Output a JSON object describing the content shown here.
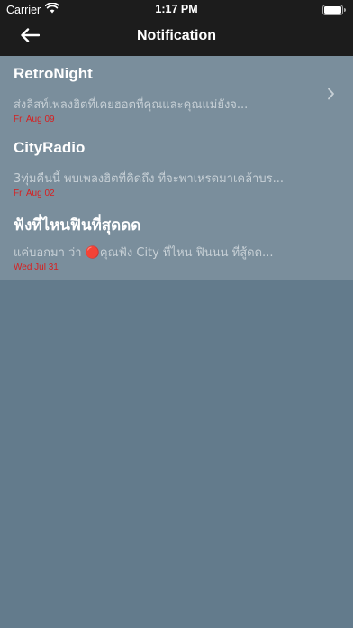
{
  "status_bar": {
    "carrier": "Carrier",
    "time": "1:17 PM",
    "icons": [
      "wifi-icon",
      "battery-icon"
    ]
  },
  "nav": {
    "title": "Notification",
    "back_icon": "back-arrow-icon"
  },
  "notifications": [
    {
      "title": "RetroNight",
      "body": "ส่งลิสท์เพลงฮิตที่เคยฮอตที่คุณและคุณแม่ยังจ...",
      "date": "Fri Aug 09",
      "has_chevron": true
    },
    {
      "title": "CityRadio",
      "body": "3ทุ่มคืนนี้ พบเพลงฮิตที่คิดถึง ที่จะพาเหรดมาเคล้าบร...",
      "date": "Fri Aug 02",
      "has_chevron": false
    },
    {
      "title": "ฟังที่ไหนฟินที่สุดดด",
      "body": "แค่บอกมา ว่า 🔴คุณฟัง City ที่ไหน ฟินนน ที่สู้ดด...",
      "date": "Wed Jul 31",
      "has_chevron": false
    }
  ],
  "colors": {
    "bar": "#1c1c1c",
    "list_bg": "#7a8e9c",
    "page_bg": "#637b8c",
    "date": "#d81f1f"
  }
}
